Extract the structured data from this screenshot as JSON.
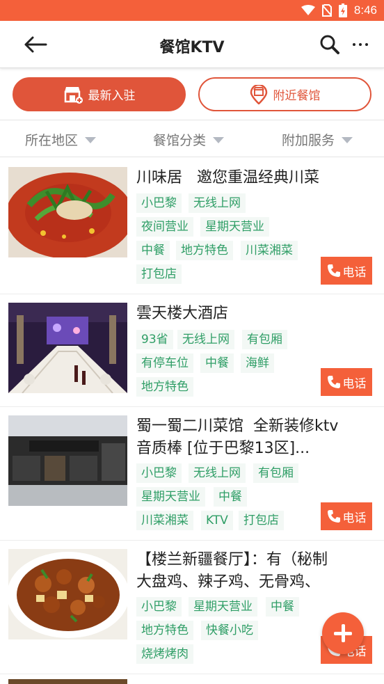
{
  "status_bar": {
    "time": "8:46",
    "icons": [
      "wifi-icon",
      "no-sim-icon",
      "battery-charging-icon"
    ],
    "color": "#f4603a"
  },
  "header": {
    "title": "餐馆KTV",
    "back_icon": "arrow-left-icon",
    "search_icon": "search-icon",
    "more_icon": "more-horizontal-icon"
  },
  "segments": {
    "latest": {
      "label": "最新入驻",
      "icon": "storefront-icon",
      "active": true
    },
    "nearby": {
      "label": "附近餐馆",
      "icon": "map-pin-shop-icon",
      "active": false
    }
  },
  "filters": [
    {
      "label": "所在地区",
      "icon": "dropdown-triangle-icon"
    },
    {
      "label": "餐馆分类",
      "icon": "dropdown-triangle-icon"
    },
    {
      "label": "附加服务",
      "icon": "dropdown-triangle-icon"
    }
  ],
  "call_label": "电话",
  "listings": [
    {
      "title_lines": [
        "川味居   邀您重温经典川菜"
      ],
      "tag_rows": [
        [
          "小巴黎",
          "无线上网"
        ],
        [
          "夜间营业",
          "星期天营业"
        ],
        [
          "中餐",
          "地方特色",
          "川菜湘菜"
        ],
        [
          "打包店"
        ]
      ]
    },
    {
      "title_lines": [
        "雲天楼大酒店"
      ],
      "tag_rows": [
        [
          "93省",
          "无线上网",
          "有包厢"
        ],
        [
          "有停车位",
          "中餐",
          "海鲜"
        ],
        [
          "地方特色"
        ]
      ]
    },
    {
      "title_lines": [
        "蜀一蜀二川菜馆  全新装修ktv",
        "音质棒 [位于巴黎13区]..."
      ],
      "tag_rows": [
        [
          "小巴黎",
          "无线上网",
          "有包厢"
        ],
        [
          "星期天营业",
          "中餐"
        ],
        [
          "川菜湘菜",
          "KTV",
          "打包店"
        ]
      ]
    },
    {
      "title_lines": [
        "【楼兰新疆餐厅】：有（秘制",
        "大盘鸡、辣子鸡、无骨鸡、"
      ],
      "tag_rows": [
        [
          "小巴黎",
          "星期天营业",
          "中餐"
        ],
        [
          "地方特色",
          "快餐小吃"
        ],
        [
          "烧烤烤肉"
        ]
      ]
    }
  ],
  "fab": {
    "icon": "plus-icon"
  },
  "colors": {
    "accent": "#f4603a",
    "tag_text": "#2f9e66",
    "tag_bg": "#f3f8f5"
  }
}
